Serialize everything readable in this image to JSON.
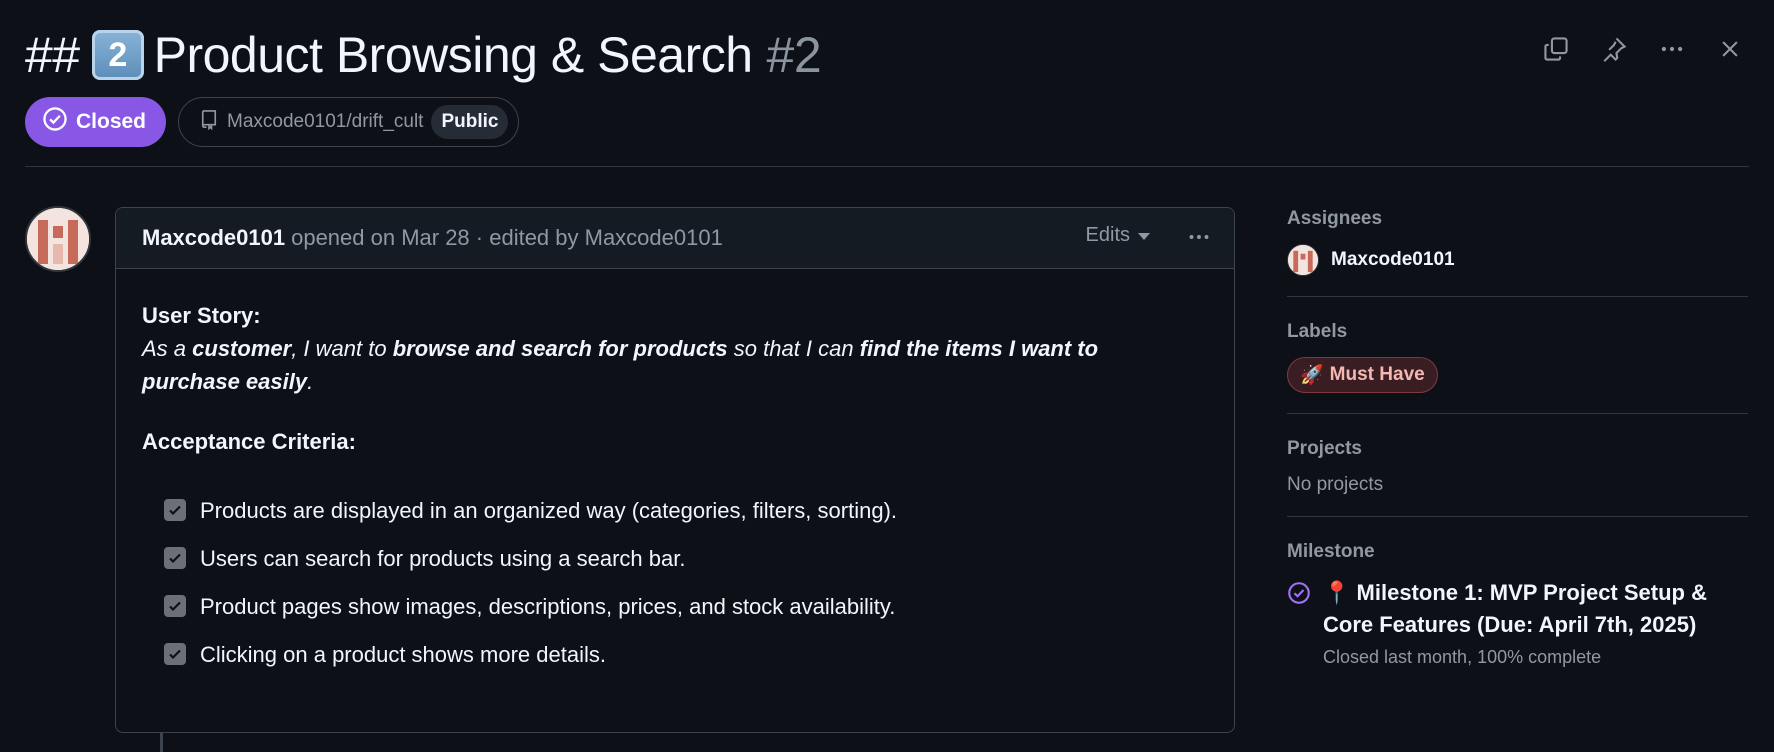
{
  "issue": {
    "title_prefix": "##",
    "keycap": "2",
    "title": "Product Browsing & Search",
    "number": "#2",
    "state": "Closed",
    "repo": "Maxcode0101/drift_cult",
    "visibility": "Public"
  },
  "comment": {
    "author": "Maxcode0101",
    "meta": "opened on Mar 28 · edited by Maxcode0101",
    "edits_label": "Edits",
    "story_heading": "User Story:",
    "story": {
      "p1": "As a ",
      "b1": "customer",
      "p2": ", I want to ",
      "b2": "browse and search for products",
      "p3": " so that I can ",
      "b3": "find the items I want to purchase easily",
      "p4": "."
    },
    "criteria_heading": "Acceptance Criteria:",
    "criteria": [
      "Products are displayed in an organized way (categories, filters, sorting).",
      "Users can search for products using a search bar.",
      "Product pages show images, descriptions, prices, and stock availability.",
      "Clicking on a product shows more details."
    ]
  },
  "sidebar": {
    "assignees_title": "Assignees",
    "assignee": "Maxcode0101",
    "labels_title": "Labels",
    "label_emoji": "🚀",
    "label": "Must Have",
    "projects_title": "Projects",
    "projects_value": "No projects",
    "milestone_title": "Milestone",
    "milestone_emoji": "📍",
    "milestone_name": "Milestone 1: MVP Project Setup & Core Features (Due: April 7th, 2025)",
    "milestone_status": "Closed last month, 100% complete"
  },
  "colors": {
    "closed_purple": "#8957e5",
    "background": "#0d1117",
    "label_bg": "#3a1d22"
  },
  "icons": [
    "copy-icon",
    "pin-icon",
    "kebab-icon",
    "close-icon",
    "check-circle-icon",
    "repo-icon",
    "triangle-down-icon",
    "checkbox-icon"
  ]
}
